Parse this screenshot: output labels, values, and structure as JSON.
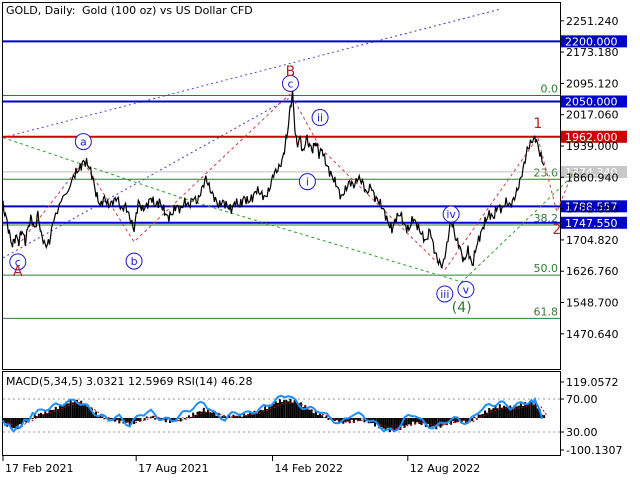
{
  "header": {
    "symbol": "GOLD, Daily:",
    "description": "Gold (100 oz) vs US Dollar CFD"
  },
  "colors": {
    "bg": "#ffffff",
    "frame": "#000000",
    "price": "#000000",
    "level_blue": "#0000cc",
    "level_red": "#cc0000",
    "fib": "#2e7d32",
    "wave_blue": "#1a1acc",
    "wave_red": "#b22222",
    "macd_hist": "#000000",
    "rsi": "#1e90ff",
    "signal": "#cc0000",
    "channel": "#4b38c9"
  },
  "chart_data": {
    "type": "line",
    "title": "GOLD, Daily:  Gold (100 oz) vs US Dollar CFD",
    "x_ticks": [
      "17 Feb 2021",
      "17 Aug 2021",
      "14 Feb 2022",
      "12 Aug 2022"
    ],
    "y_ticks": [
      "2251.240",
      "2173.180",
      "2095.120",
      "2017.060",
      "1939.000",
      "1860.940",
      "1782.880",
      "1704.820",
      "1626.760",
      "1548.700",
      "1470.640"
    ],
    "ylim": [
      1430.0,
      2275.0
    ],
    "price_path": [
      [
        0,
        1790
      ],
      [
        3,
        1760
      ],
      [
        6,
        1720
      ],
      [
        9,
        1690
      ],
      [
        12,
        1715
      ],
      [
        15,
        1700
      ],
      [
        18,
        1730
      ],
      [
        21,
        1700
      ],
      [
        24,
        1740
      ],
      [
        27,
        1760
      ],
      [
        30,
        1730
      ],
      [
        33,
        1770
      ],
      [
        36,
        1720
      ],
      [
        40,
        1690
      ],
      [
        44,
        1700
      ],
      [
        48,
        1760
      ],
      [
        55,
        1800
      ],
      [
        62,
        1830
      ],
      [
        68,
        1870
      ],
      [
        72,
        1880
      ],
      [
        76,
        1900
      ],
      [
        80,
        1895
      ],
      [
        84,
        1870
      ],
      [
        88,
        1820
      ],
      [
        92,
        1790
      ],
      [
        96,
        1810
      ],
      [
        100,
        1790
      ],
      [
        104,
        1800
      ],
      [
        108,
        1810
      ],
      [
        112,
        1780
      ],
      [
        116,
        1790
      ],
      [
        120,
        1760
      ],
      [
        124,
        1730
      ],
      [
        128,
        1800
      ],
      [
        132,
        1780
      ],
      [
        136,
        1790
      ],
      [
        140,
        1810
      ],
      [
        144,
        1790
      ],
      [
        148,
        1800
      ],
      [
        152,
        1780
      ],
      [
        156,
        1760
      ],
      [
        160,
        1770
      ],
      [
        164,
        1790
      ],
      [
        168,
        1780
      ],
      [
        172,
        1800
      ],
      [
        176,
        1790
      ],
      [
        180,
        1810
      ],
      [
        184,
        1800
      ],
      [
        188,
        1830
      ],
      [
        192,
        1860
      ],
      [
        196,
        1830
      ],
      [
        200,
        1810
      ],
      [
        204,
        1790
      ],
      [
        208,
        1800
      ],
      [
        212,
        1790
      ],
      [
        216,
        1780
      ],
      [
        220,
        1800
      ],
      [
        224,
        1790
      ],
      [
        228,
        1810
      ],
      [
        232,
        1800
      ],
      [
        236,
        1810
      ],
      [
        240,
        1830
      ],
      [
        244,
        1820
      ],
      [
        248,
        1810
      ],
      [
        252,
        1830
      ],
      [
        256,
        1870
      ],
      [
        260,
        1880
      ],
      [
        264,
        1900
      ],
      [
        267,
        1940
      ],
      [
        270,
        1990
      ],
      [
        272,
        2040
      ],
      [
        274,
        2070
      ],
      [
        276,
        1990
      ],
      [
        278,
        1940
      ],
      [
        281,
        1960
      ],
      [
        284,
        1920
      ],
      [
        287,
        1960
      ],
      [
        290,
        1940
      ],
      [
        293,
        1930
      ],
      [
        296,
        1950
      ],
      [
        299,
        1920
      ],
      [
        302,
        1930
      ],
      [
        305,
        1900
      ],
      [
        308,
        1880
      ],
      [
        312,
        1860
      ],
      [
        316,
        1840
      ],
      [
        320,
        1810
      ],
      [
        324,
        1830
      ],
      [
        328,
        1850
      ],
      [
        332,
        1840
      ],
      [
        336,
        1860
      ],
      [
        340,
        1850
      ],
      [
        344,
        1820
      ],
      [
        348,
        1840
      ],
      [
        352,
        1810
      ],
      [
        356,
        1800
      ],
      [
        360,
        1780
      ],
      [
        364,
        1750
      ],
      [
        368,
        1730
      ],
      [
        372,
        1760
      ],
      [
        376,
        1770
      ],
      [
        380,
        1740
      ],
      [
        384,
        1730
      ],
      [
        388,
        1760
      ],
      [
        392,
        1740
      ],
      [
        396,
        1720
      ],
      [
        400,
        1700
      ],
      [
        404,
        1730
      ],
      [
        408,
        1680
      ],
      [
        412,
        1650
      ],
      [
        416,
        1640
      ],
      [
        420,
        1690
      ],
      [
        424,
        1760
      ],
      [
        428,
        1710
      ],
      [
        432,
        1690
      ],
      [
        436,
        1650
      ],
      [
        440,
        1680
      ],
      [
        444,
        1640
      ],
      [
        448,
        1690
      ],
      [
        452,
        1720
      ],
      [
        456,
        1750
      ],
      [
        460,
        1770
      ],
      [
        464,
        1760
      ],
      [
        468,
        1790
      ],
      [
        472,
        1780
      ],
      [
        476,
        1800
      ],
      [
        480,
        1790
      ],
      [
        484,
        1810
      ],
      [
        488,
        1840
      ],
      [
        492,
        1880
      ],
      [
        496,
        1930
      ],
      [
        500,
        1950
      ],
      [
        504,
        1960
      ],
      [
        508,
        1920
      ],
      [
        512,
        1890
      ]
    ],
    "macd_hist": [
      [
        0,
        -8
      ],
      [
        6,
        -14
      ],
      [
        12,
        -20
      ],
      [
        18,
        -10
      ],
      [
        24,
        -5
      ],
      [
        30,
        4
      ],
      [
        40,
        10
      ],
      [
        50,
        16
      ],
      [
        60,
        26
      ],
      [
        70,
        30
      ],
      [
        80,
        20
      ],
      [
        90,
        5
      ],
      [
        100,
        -3
      ],
      [
        110,
        -6
      ],
      [
        120,
        -10
      ],
      [
        130,
        -4
      ],
      [
        140,
        3
      ],
      [
        150,
        -4
      ],
      [
        160,
        -6
      ],
      [
        170,
        -2
      ],
      [
        180,
        6
      ],
      [
        190,
        14
      ],
      [
        200,
        8
      ],
      [
        210,
        2
      ],
      [
        220,
        4
      ],
      [
        230,
        6
      ],
      [
        240,
        10
      ],
      [
        250,
        18
      ],
      [
        260,
        28
      ],
      [
        270,
        30
      ],
      [
        280,
        26
      ],
      [
        290,
        14
      ],
      [
        300,
        6
      ],
      [
        310,
        -2
      ],
      [
        320,
        -8
      ],
      [
        330,
        -6
      ],
      [
        340,
        -3
      ],
      [
        350,
        -10
      ],
      [
        360,
        -18
      ],
      [
        370,
        -22
      ],
      [
        380,
        -14
      ],
      [
        390,
        -8
      ],
      [
        400,
        -12
      ],
      [
        410,
        -16
      ],
      [
        420,
        -10
      ],
      [
        430,
        -6
      ],
      [
        440,
        -8
      ],
      [
        450,
        4
      ],
      [
        460,
        14
      ],
      [
        470,
        20
      ],
      [
        480,
        18
      ],
      [
        490,
        22
      ],
      [
        500,
        26
      ],
      [
        505,
        22
      ],
      [
        510,
        6
      ]
    ],
    "rsi": [
      [
        0,
        44
      ],
      [
        6,
        36
      ],
      [
        12,
        32
      ],
      [
        18,
        40
      ],
      [
        24,
        46
      ],
      [
        30,
        52
      ],
      [
        40,
        58
      ],
      [
        50,
        62
      ],
      [
        60,
        66
      ],
      [
        70,
        68
      ],
      [
        80,
        60
      ],
      [
        90,
        50
      ],
      [
        100,
        46
      ],
      [
        110,
        48
      ],
      [
        120,
        38
      ],
      [
        130,
        52
      ],
      [
        140,
        54
      ],
      [
        150,
        46
      ],
      [
        160,
        44
      ],
      [
        170,
        52
      ],
      [
        180,
        60
      ],
      [
        190,
        66
      ],
      [
        200,
        52
      ],
      [
        210,
        46
      ],
      [
        220,
        54
      ],
      [
        230,
        52
      ],
      [
        240,
        56
      ],
      [
        250,
        62
      ],
      [
        260,
        70
      ],
      [
        270,
        76
      ],
      [
        280,
        62
      ],
      [
        290,
        58
      ],
      [
        300,
        56
      ],
      [
        310,
        46
      ],
      [
        320,
        40
      ],
      [
        330,
        52
      ],
      [
        340,
        50
      ],
      [
        350,
        42
      ],
      [
        360,
        34
      ],
      [
        370,
        30
      ],
      [
        380,
        46
      ],
      [
        390,
        52
      ],
      [
        400,
        38
      ],
      [
        410,
        36
      ],
      [
        420,
        44
      ],
      [
        430,
        46
      ],
      [
        440,
        40
      ],
      [
        450,
        56
      ],
      [
        460,
        62
      ],
      [
        470,
        66
      ],
      [
        480,
        60
      ],
      [
        490,
        64
      ],
      [
        500,
        68
      ],
      [
        505,
        66
      ],
      [
        510,
        46
      ]
    ],
    "levels": [
      {
        "value": 2200.0,
        "label": "2200.000",
        "kind": "blue"
      },
      {
        "value": 2050.0,
        "label": "2050.000",
        "kind": "blue"
      },
      {
        "value": 1962.0,
        "label": "1962.000",
        "kind": "red"
      },
      {
        "value": 1874.34,
        "label": "1874.340",
        "kind": "current"
      },
      {
        "value": 1788.557,
        "label": "1788.557",
        "kind": "blue"
      },
      {
        "value": 1747.55,
        "label": "1747.550",
        "kind": "blue"
      }
    ],
    "fib_levels": [
      {
        "value": 2065.0,
        "label": "0.0"
      },
      {
        "value": 1856.0,
        "label": "23.6"
      },
      {
        "value": 1742.0,
        "label": "38.2"
      },
      {
        "value": 1617.0,
        "label": "50.0"
      },
      {
        "value": 1509.0,
        "label": "61.8"
      }
    ],
    "wave_labels_circled": [
      {
        "t": 14,
        "v": 1650,
        "text": "c"
      },
      {
        "t": 76,
        "v": 1950,
        "text": "a"
      },
      {
        "t": 124,
        "v": 1652,
        "text": "b"
      },
      {
        "t": 272,
        "v": 2095,
        "text": "c"
      },
      {
        "t": 300,
        "v": 2010,
        "text": "ii"
      },
      {
        "t": 288,
        "v": 1850,
        "text": "i"
      },
      {
        "t": 424,
        "v": 1769,
        "text": "iv"
      },
      {
        "t": 418,
        "v": 1570,
        "text": "iii"
      },
      {
        "t": 438,
        "v": 1581,
        "text": "v"
      }
    ],
    "wave_labels_plain": [
      {
        "t": 272,
        "v": 2114,
        "text": "B",
        "color": "red"
      },
      {
        "t": 14,
        "v": 1615,
        "text": "A",
        "color": "red"
      },
      {
        "t": 506,
        "v": 1984,
        "text": "1",
        "color": "red"
      },
      {
        "t": 524,
        "v": 1720,
        "text": "2",
        "color": "red"
      },
      {
        "t": 434,
        "v": 1525,
        "text": "(4)",
        "color": "green"
      }
    ],
    "macd_label": "MACD(5,34,5) 3.0321 12.5969 RSI(14) 46.28",
    "macd_ticks": [
      "119.0572",
      "70.00",
      "30.00",
      "-100.1307"
    ]
  }
}
